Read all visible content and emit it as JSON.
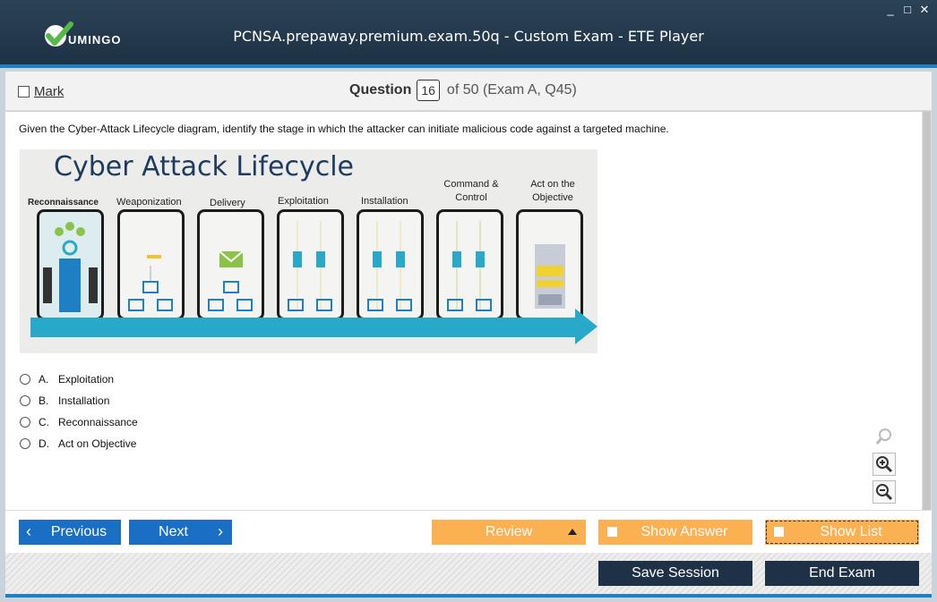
{
  "app": {
    "logo_text": "UMINGO",
    "window_title": "PCNSA.prepaway.premium.exam.50q - Custom Exam - ETE Player",
    "window_controls": [
      "_",
      "□",
      "✕"
    ]
  },
  "question_header": {
    "mark_label": "Mark",
    "question_word": "Question",
    "question_number": "16",
    "of_text": "of 50 (Exam A, Q45)"
  },
  "question": {
    "text": "Given the Cyber-Attack Lifecycle diagram, identify the stage in which the attacker can initiate malicious code against a targeted machine.",
    "diagram": {
      "title": "Cyber Attack Lifecycle",
      "stages": [
        "Reconnaissance",
        "Weaponization",
        "Delivery",
        "Exploitation",
        "Installation",
        "Command & Control",
        "Act on the Objective"
      ]
    },
    "options": [
      {
        "letter": "A.",
        "text": "Exploitation"
      },
      {
        "letter": "B.",
        "text": "Installation"
      },
      {
        "letter": "C.",
        "text": "Reconnaissance"
      },
      {
        "letter": "D.",
        "text": "Act on Objective"
      }
    ]
  },
  "nav": {
    "previous": "Previous",
    "next": "Next",
    "review": "Review",
    "show_answer": "Show Answer",
    "show_list": "Show List",
    "save_session": "Save Session",
    "end_exam": "End Exam"
  },
  "colors": {
    "titlebar": "#1d3244",
    "accent_blue": "#1a6fc4",
    "orange": "#fbb052",
    "dark_button": "#1f3146",
    "diagram_arrow": "#29a9c9"
  },
  "icons": [
    "check-logo-icon",
    "minimize-icon",
    "maximize-icon",
    "close-icon",
    "search-icon",
    "zoom-in-icon",
    "zoom-out-icon",
    "chevron-left-icon",
    "chevron-right-icon",
    "triangle-up-icon"
  ]
}
